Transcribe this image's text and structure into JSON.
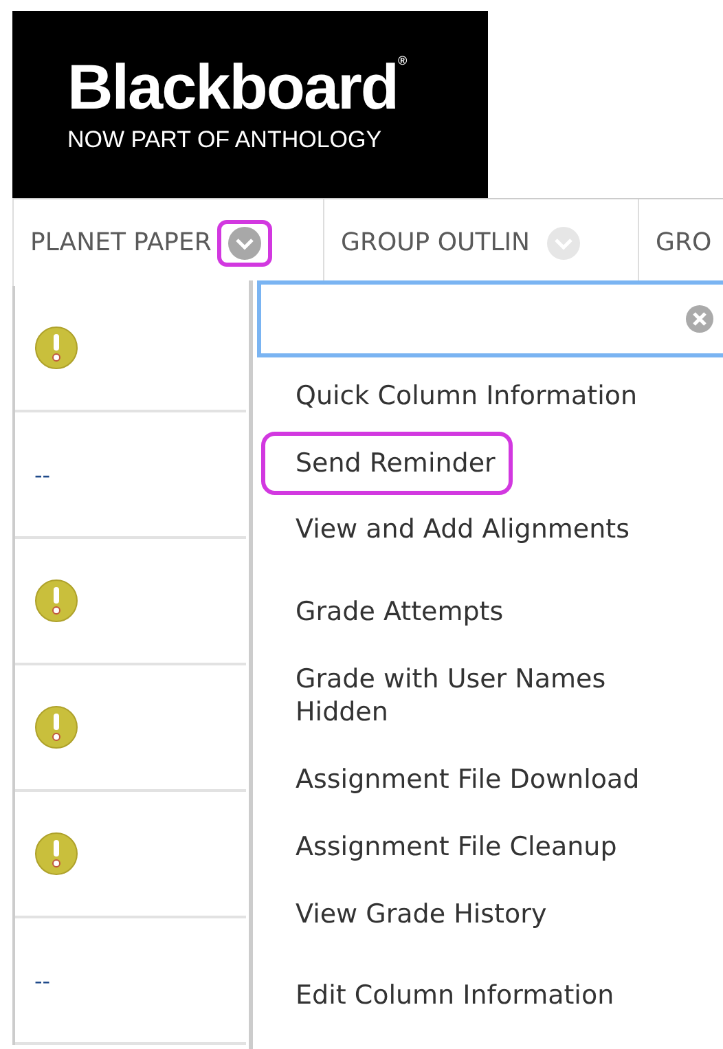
{
  "logo": {
    "wordmark": "Blackboard$^{®}$",
    "tagline": "NOW PART OF ANTHOLOGY"
  },
  "columns": [
    {
      "label": "PLANET PAPER",
      "menu_button": {
        "active": true,
        "highlighted": true
      }
    },
    {
      "label": "GROUP OUTLIN",
      "menu_button": {
        "active": false,
        "highlighted": false
      }
    },
    {
      "label": "GRO"
    }
  ],
  "rows": [
    {
      "kind": "alert"
    },
    {
      "kind": "text",
      "text": "--"
    },
    {
      "kind": "alert"
    },
    {
      "kind": "alert"
    },
    {
      "kind": "alert"
    },
    {
      "kind": "text",
      "text": "--"
    }
  ],
  "menu": {
    "search": {
      "focused": true
    },
    "items": [
      {
        "label": "Quick Column Information",
        "highlighted": false
      },
      {
        "label": "Send Reminder",
        "highlighted": true
      },
      {
        "label": "View and Add Alignments",
        "highlighted": false
      },
      {
        "label": "Grade Attempts",
        "highlighted": false
      },
      {
        "label": "Grade with User Names Hidden",
        "highlighted": false
      },
      {
        "label": "Assignment File Download",
        "highlighted": false
      },
      {
        "label": "Assignment File Cleanup",
        "highlighted": false
      },
      {
        "label": "View Grade History",
        "highlighted": false
      },
      {
        "label": "Edit Column Information",
        "highlighted": false
      }
    ]
  }
}
